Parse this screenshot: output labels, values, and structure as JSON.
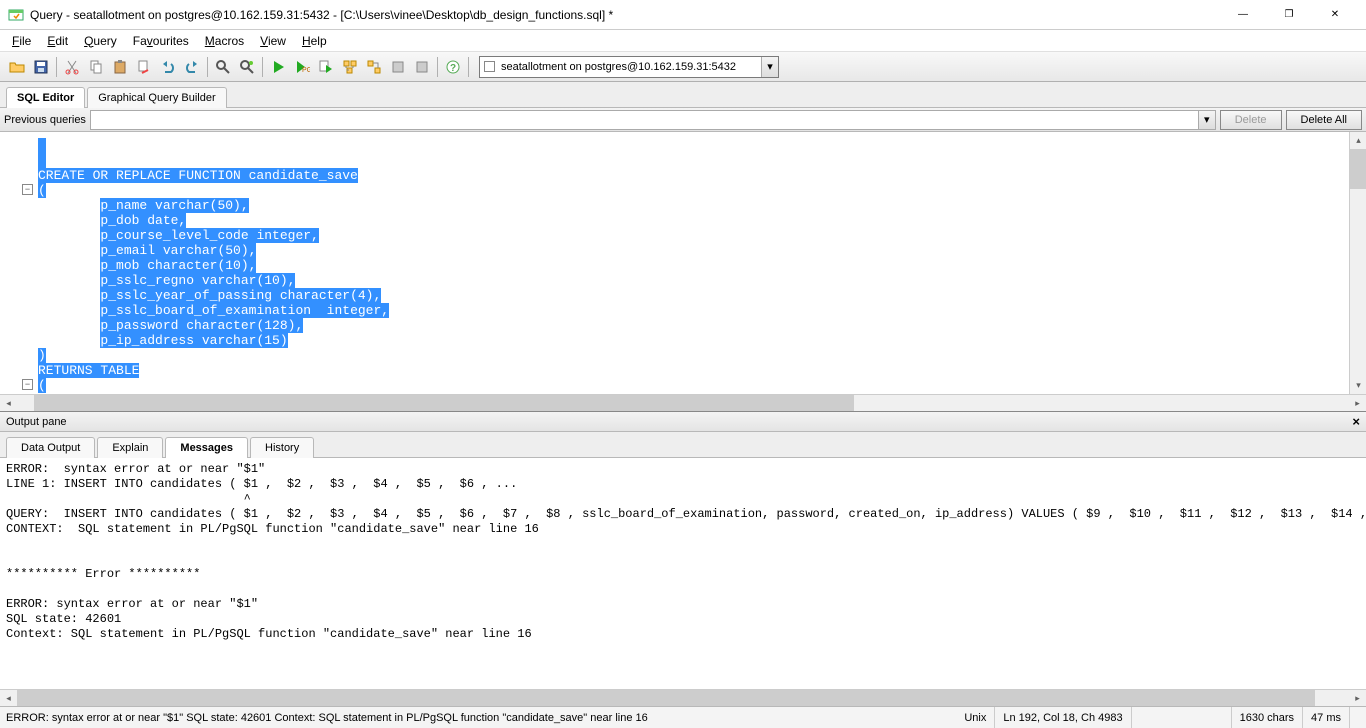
{
  "window": {
    "title": "Query - seatallotment on postgres@10.162.159.31:5432 - [C:\\Users\\vinee\\Desktop\\db_design_functions.sql] *"
  },
  "menu": {
    "file": "File",
    "edit": "Edit",
    "query": "Query",
    "favourites": "Favourites",
    "macros": "Macros",
    "view": "View",
    "help": "Help"
  },
  "connection": "seatallotment on postgres@10.162.159.31:5432",
  "main_tabs": {
    "sql_editor": "SQL Editor",
    "graphical": "Graphical Query Builder"
  },
  "prev": {
    "label": "Previous queries",
    "delete": "Delete",
    "delete_all": "Delete All"
  },
  "code_lines": [
    "",
    "",
    "CREATE OR REPLACE FUNCTION candidate_save",
    "(",
    "        p_name varchar(50),",
    "        p_dob date,",
    "        p_course_level_code integer,",
    "        p_email varchar(50),",
    "        p_mob character(10),",
    "        p_sslc_regno varchar(10),",
    "        p_sslc_year_of_passing character(4),",
    "        p_sslc_board_of_examination  integer,",
    "        p_password character(128),",
    "        p_ip_address varchar(15)",
    ")",
    "RETURNS TABLE",
    "("
  ],
  "output": {
    "pane_label": "Output pane",
    "tabs": {
      "data": "Data Output",
      "explain": "Explain",
      "messages": "Messages",
      "history": "History"
    },
    "body": "ERROR:  syntax error at or near \"$1\"\nLINE 1: INSERT INTO candidates ( $1 ,  $2 ,  $3 ,  $4 ,  $5 ,  $6 , ...\n                                 ^\nQUERY:  INSERT INTO candidates ( $1 ,  $2 ,  $3 ,  $4 ,  $5 ,  $6 ,  $7 ,  $8 , sslc_board_of_examination, password, created_on, ip_address) VALUES ( $9 ,  $10 ,  $11 ,  $12 ,  $13 ,  $14 ,\nCONTEXT:  SQL statement in PL/PgSQL function \"candidate_save\" near line 16\n\n\n********** Error **********\n\nERROR: syntax error at or near \"$1\"\nSQL state: 42601\nContext: SQL statement in PL/PgSQL function \"candidate_save\" near line 16"
  },
  "status": {
    "error": "ERROR: syntax error at or near \"$1\" SQL state: 42601 Context: SQL statement in PL/PgSQL function \"candidate_save\" near line 16",
    "os": "Unix",
    "pos": "Ln 192, Col 18, Ch 4983",
    "chars": "1630 chars",
    "time": "47 ms"
  }
}
